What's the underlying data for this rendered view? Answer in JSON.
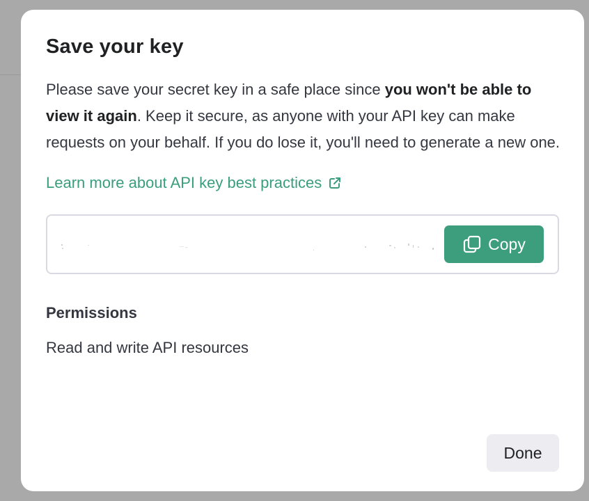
{
  "modal": {
    "title": "Save your key",
    "description_part1": "Please save your secret key in a safe place since ",
    "description_bold": "you won't be able to view it again",
    "description_part2": ". Keep it secure, as anyone with your API key can make requests on your behalf. If you do lose it, you'll need to generate a new one.",
    "learn_more_link": "Learn more about API key best practices",
    "learn_more_icon": "external-link-icon",
    "key_field": {
      "value": ""
    },
    "copy_button": {
      "label": "Copy",
      "icon": "copy-icon",
      "color": "#3d9e7e"
    },
    "permissions": {
      "heading": "Permissions",
      "value": "Read and write API resources"
    },
    "done_button": {
      "label": "Done"
    }
  },
  "colors": {
    "backdrop": "#a9a9a9",
    "link": "#3a9e7e",
    "accent": "#3d9e7e"
  }
}
